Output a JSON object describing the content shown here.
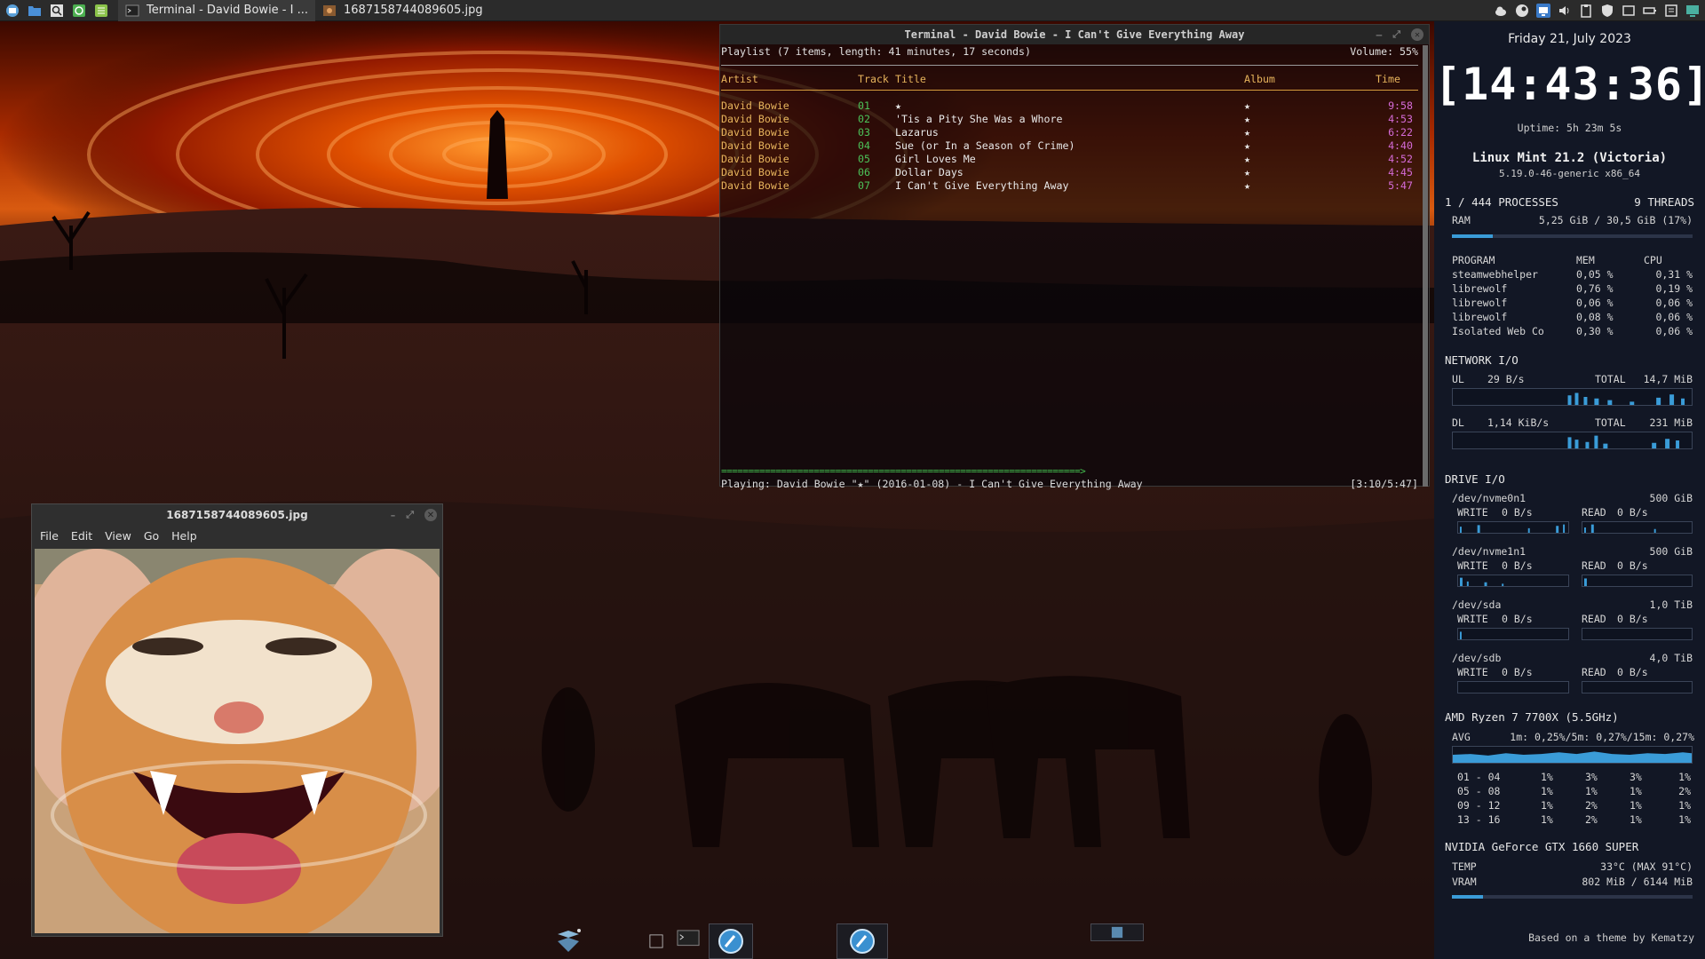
{
  "top_panel": {
    "launchers": [
      {
        "icon": "mint-menu-icon"
      },
      {
        "icon": "folder-icon"
      },
      {
        "icon": "search-icon"
      },
      {
        "icon": "recycle-icon"
      },
      {
        "icon": "notes-icon"
      }
    ],
    "tasks": [
      {
        "icon": "terminal-icon",
        "label": "Terminal - David Bowie - I ..."
      },
      {
        "icon": "image-icon",
        "label": "1687158744089605.jpg"
      }
    ],
    "tray_icons": [
      "cloud-icon",
      "steam-icon",
      "network-icon",
      "volume-icon",
      "clipboard-icon",
      "shield-icon",
      "window-icon",
      "battery-icon",
      "notes-icon",
      "display-icon"
    ]
  },
  "terminal": {
    "title": "Terminal - David Bowie - I Can't Give Everything Away",
    "playlist_summary": "Playlist (7 items, length: 41 minutes, 17 seconds)",
    "volume": "Volume: 55%",
    "columns": {
      "artist": "Artist",
      "track": "Track",
      "title": "Title",
      "album": "Album",
      "time": "Time"
    },
    "tracks": [
      {
        "artist": "David Bowie",
        "track": "01",
        "title": "★",
        "album": "★",
        "time": "9:58"
      },
      {
        "artist": "David Bowie",
        "track": "02",
        "title": "'Tis a Pity She Was a Whore",
        "album": "★",
        "time": "4:53"
      },
      {
        "artist": "David Bowie",
        "track": "03",
        "title": "Lazarus",
        "album": "★",
        "time": "6:22"
      },
      {
        "artist": "David Bowie",
        "track": "04",
        "title": "Sue (or In a Season of Crime)",
        "album": "★",
        "time": "4:40"
      },
      {
        "artist": "David Bowie",
        "track": "05",
        "title": "Girl Loves Me",
        "album": "★",
        "time": "4:52"
      },
      {
        "artist": "David Bowie",
        "track": "06",
        "title": "Dollar Days",
        "album": "★",
        "time": "4:45"
      },
      {
        "artist": "David Bowie",
        "track": "07",
        "title": "I Can't Give Everything Away",
        "album": "★",
        "time": "5:47"
      }
    ],
    "progress_bar": "==================================================================>",
    "playing": "Playing: David Bowie \"★\" (2016-01-08) - I Can't Give Everything Away",
    "elapsed": "[3:10/5:47]",
    "colors": {
      "artist": "#e7b45c",
      "track": "#4cc35a",
      "time": "#d56bd8",
      "progress": "#44c04f"
    }
  },
  "viewer": {
    "title": "1687158744089605.jpg",
    "menu": [
      "File",
      "Edit",
      "View",
      "Go",
      "Help"
    ]
  },
  "conky": {
    "date": "Friday 21, July 2023",
    "time": "[14:43:36]",
    "uptime": "Uptime: 5h 23m 5s",
    "distro": "Linux Mint 21.2 (Victoria)",
    "kernel": "5.19.0-46-generic x86_64",
    "processes": "1 / 444 PROCESSES",
    "threads": "9 THREADS",
    "ram_label": "RAM",
    "ram_value": "5,25 GiB / 30,5 GiB (17%)",
    "ram_fraction": 0.17,
    "proc_headers": {
      "program": "PROGRAM",
      "mem": "MEM",
      "cpu": "CPU"
    },
    "procs": [
      {
        "name": "steamwebhelper",
        "mem": "0,05 %",
        "cpu": "0,31 %"
      },
      {
        "name": "librewolf",
        "mem": "0,76 %",
        "cpu": "0,19 %"
      },
      {
        "name": "librewolf",
        "mem": "0,06 %",
        "cpu": "0,06 %"
      },
      {
        "name": "librewolf",
        "mem": "0,08 %",
        "cpu": "0,06 %"
      },
      {
        "name": "Isolated Web Co",
        "mem": "0,30 %",
        "cpu": "0,06 %"
      }
    ],
    "network": {
      "title": "NETWORK I/O",
      "ul_label": "UL",
      "ul_rate": "29 B/s",
      "ul_total_label": "TOTAL",
      "ul_total": "14,7 MiB",
      "dl_label": "DL",
      "dl_rate": "1,14 KiB/s",
      "dl_total_label": "TOTAL",
      "dl_total": "231 MiB"
    },
    "drive_title": "DRIVE I/O",
    "drives": [
      {
        "name": "/dev/nvme0n1",
        "size": "500 GiB",
        "write_label": "WRITE",
        "write": "0 B/s",
        "read_label": "READ",
        "read": "0 B/s"
      },
      {
        "name": "/dev/nvme1n1",
        "size": "500 GiB",
        "write_label": "WRITE",
        "write": "0 B/s",
        "read_label": "READ",
        "read": "0 B/s"
      },
      {
        "name": "/dev/sda",
        "size": "1,0 TiB",
        "write_label": "WRITE",
        "write": "0 B/s",
        "read_label": "READ",
        "read": "0 B/s"
      },
      {
        "name": "/dev/sdb",
        "size": "4,0 TiB",
        "write_label": "WRITE",
        "write": "0 B/s",
        "read_label": "READ",
        "read": "0 B/s"
      }
    ],
    "cpu": {
      "title": "AMD Ryzen 7 7700X (5.5GHz)",
      "avg_label": "AVG",
      "load": "1m: 0,25%/5m: 0,27%/15m: 0,27%",
      "cores": [
        {
          "range": "01 - 04",
          "v": [
            "1%",
            "3%",
            "3%",
            "1%"
          ]
        },
        {
          "range": "05 - 08",
          "v": [
            "1%",
            "1%",
            "1%",
            "2%"
          ]
        },
        {
          "range": "09 - 12",
          "v": [
            "1%",
            "2%",
            "1%",
            "1%"
          ]
        },
        {
          "range": "13 - 16",
          "v": [
            "1%",
            "2%",
            "1%",
            "1%"
          ]
        }
      ]
    },
    "gpu": {
      "title": "NVIDIA GeForce GTX 1660 SUPER",
      "temp_label": "TEMP",
      "temp": "33°C (MAX 91°C)",
      "vram_label": "VRAM",
      "vram": "802 MiB / 6144 MiB",
      "vram_fraction": 0.13
    },
    "credit": "Based on a theme by Kematzy"
  },
  "dock": {
    "items": [
      "app-grid-icon",
      "workspace-icon",
      "terminal-icon",
      "browser-icon",
      "browser-icon",
      "window-preview-icon"
    ]
  }
}
